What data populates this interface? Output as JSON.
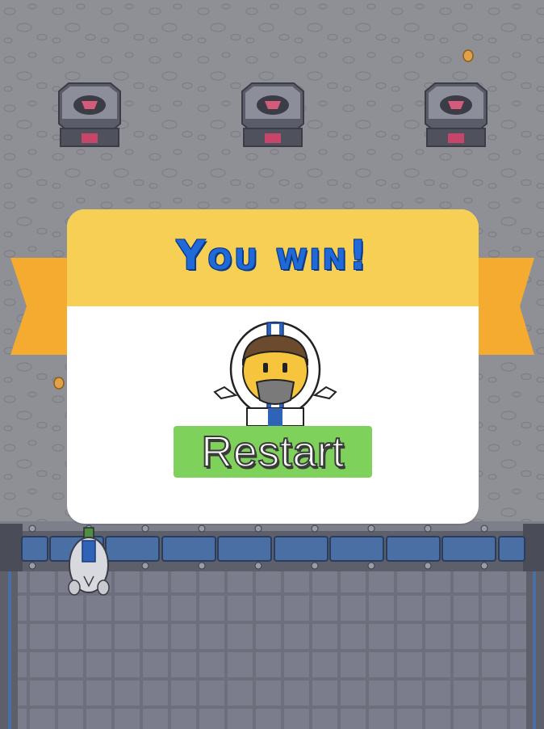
{
  "dialog": {
    "title": "You win!",
    "restart_label": "Restart"
  },
  "colors": {
    "ground": "#8f9096",
    "banner_header": "#f7cf54",
    "ribbon": "#f5ab2f",
    "title_text": "#1f69d8",
    "restart_button": "#7ed15b",
    "rail_blue": "#4a6fa5"
  },
  "icons": {
    "enemy_bunker": "bunker-icon",
    "astronaut": "astronaut-icon",
    "player_turret": "player-turret-icon"
  }
}
